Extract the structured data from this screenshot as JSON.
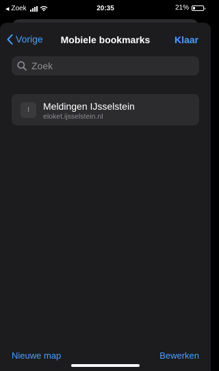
{
  "status_bar": {
    "back_app": "Zoek",
    "time": "20:35",
    "battery_percent_label": "21%",
    "battery_level": 0.21
  },
  "nav": {
    "back_label": "Vorige",
    "title": "Mobiele bookmarks",
    "done_label": "Klaar"
  },
  "search": {
    "placeholder": "Zoek",
    "icon": "search-icon"
  },
  "bookmarks": [
    {
      "favicon_letter": "I",
      "title": "Meldingen IJsselstein",
      "url": "eloket.ijsselstein.nl"
    }
  ],
  "toolbar": {
    "new_folder_label": "Nieuwe map",
    "edit_label": "Bewerken"
  },
  "colors": {
    "accent": "#4a9fff",
    "sheet_background": "#1c1c1e",
    "row_background": "#2c2c2e",
    "secondary_text": "#8e8e93"
  }
}
